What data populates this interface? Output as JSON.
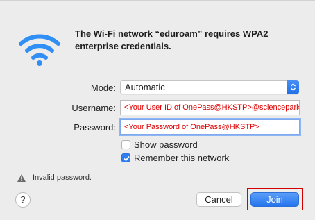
{
  "dialog": {
    "headline": "The Wi-Fi network “eduroam” requires WPA2 enterprise credentials."
  },
  "form": {
    "mode_label": "Mode:",
    "mode_value": "Automatic",
    "username_label": "Username:",
    "username_value": "<Your User ID of OnePass@HKSTP>@sciencepark.hk",
    "password_label": "Password:",
    "password_value": "<Your Password of OnePass@HKSTP>",
    "show_password_label": "Show password",
    "show_password_checked": false,
    "remember_label": "Remember this network",
    "remember_checked": true
  },
  "status": {
    "message": "Invalid password.",
    "icon": "warning-icon"
  },
  "buttons": {
    "help_label": "?",
    "cancel_label": "Cancel",
    "join_label": "Join"
  },
  "colors": {
    "accent": "#2f7ff3",
    "field_text": "#e00000",
    "highlight_outline": "#d40000"
  }
}
